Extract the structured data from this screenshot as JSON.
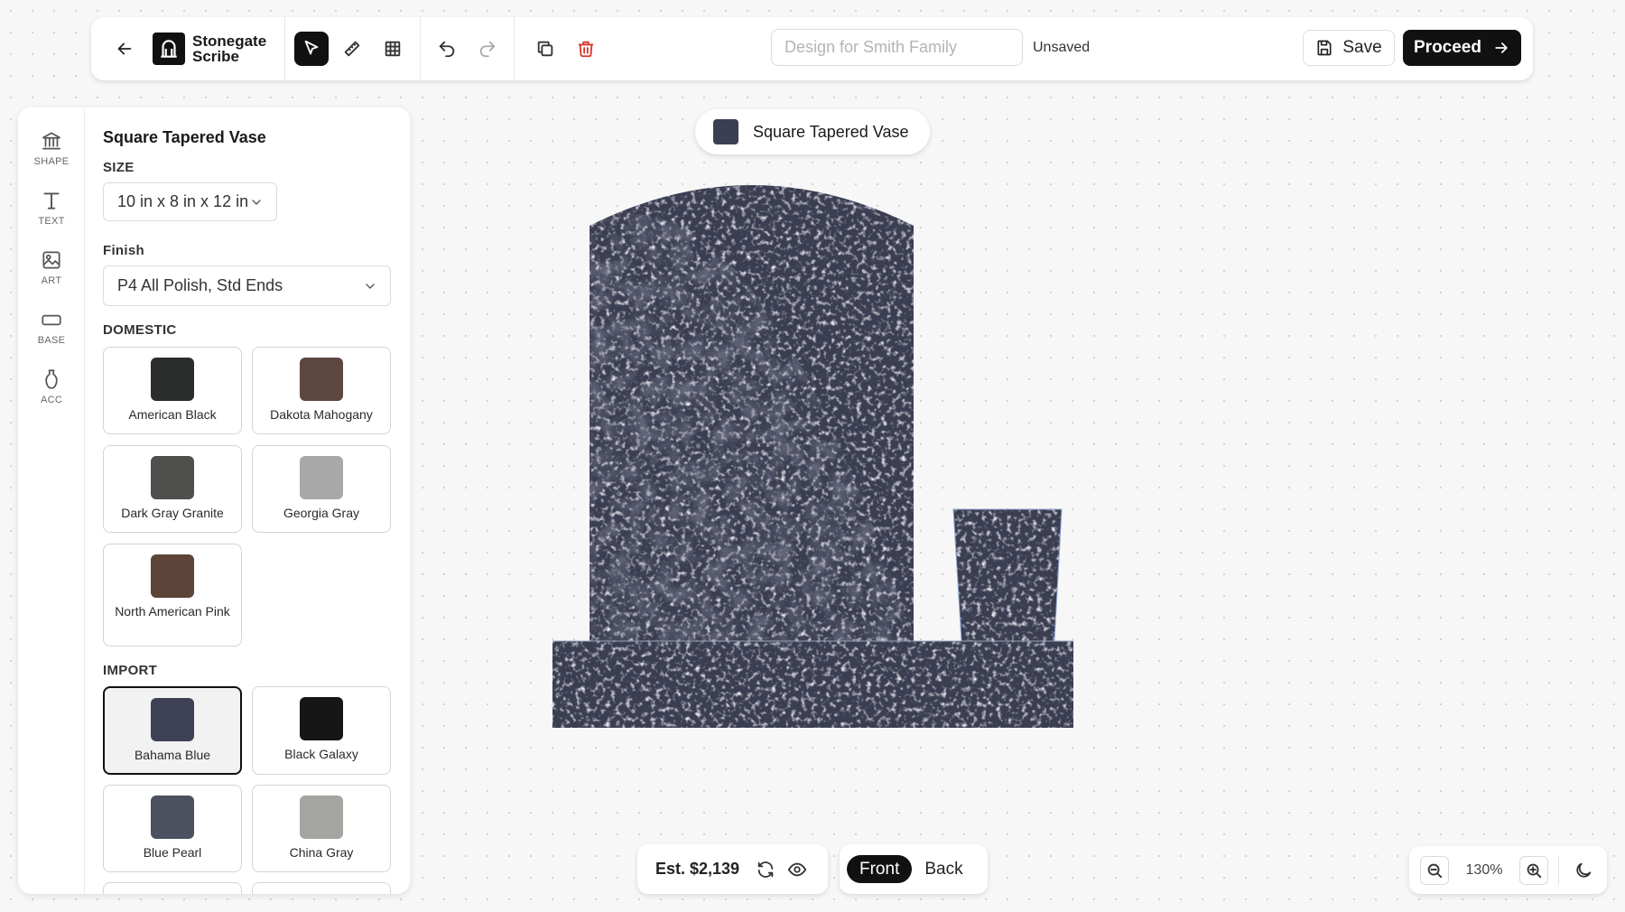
{
  "app": {
    "brand_line1": "Stonegate",
    "brand_line2": "Scribe"
  },
  "toolbar": {
    "back_icon": "arrow-left-icon",
    "tools": [
      "pointer-icon",
      "ruler-icon",
      "grid-icon"
    ],
    "history": [
      "undo-icon",
      "redo-icon"
    ],
    "actions": [
      "duplicate-icon",
      "trash-icon"
    ],
    "design_name_placeholder": "Design for Smith Family",
    "save_state": "Unsaved",
    "save_label": "Save",
    "proceed_label": "Proceed",
    "delete_color": "#d9352b"
  },
  "rail": {
    "items": [
      {
        "label": "SHAPE",
        "icon": "monument-icon"
      },
      {
        "label": "TEXT",
        "icon": "text-icon"
      },
      {
        "label": "ART",
        "icon": "image-icon"
      },
      {
        "label": "BASE",
        "icon": "base-icon"
      },
      {
        "label": "ACC",
        "icon": "vase-icon"
      }
    ]
  },
  "props": {
    "title": "Square Tapered Vase",
    "size_label": "SIZE",
    "size_value": "10 in x 8 in x 12 in",
    "finish_label": "Finish",
    "finish_value": "P4 All Polish, Std Ends",
    "domestic_label": "DOMESTIC",
    "domestic": [
      {
        "name": "American Black",
        "color": "#2b2d2c"
      },
      {
        "name": "Dakota Mahogany",
        "color": "#5e4741"
      },
      {
        "name": "Dark Gray Granite",
        "color": "#4f4f4d"
      },
      {
        "name": "Georgia Gray",
        "color": "#a8a8a8"
      },
      {
        "name": "North American Pink",
        "color": "#5e4438"
      }
    ],
    "import_label": "IMPORT",
    "import": [
      {
        "name": "Bahama Blue",
        "color": "#3e4156",
        "selected": true
      },
      {
        "name": "Black Galaxy",
        "color": "#161616",
        "selected": false
      },
      {
        "name": "Blue Pearl",
        "color": "#4c5160",
        "selected": false
      },
      {
        "name": "China Gray",
        "color": "#a4a4a0",
        "selected": false
      }
    ]
  },
  "canvas": {
    "layer_label": "Square Tapered Vase",
    "stone_color": "#3b3e52"
  },
  "bottom": {
    "price": "Est. $2,139",
    "front_label": "Front",
    "back_label": "Back",
    "active_view": "Front",
    "zoom": "130%"
  }
}
